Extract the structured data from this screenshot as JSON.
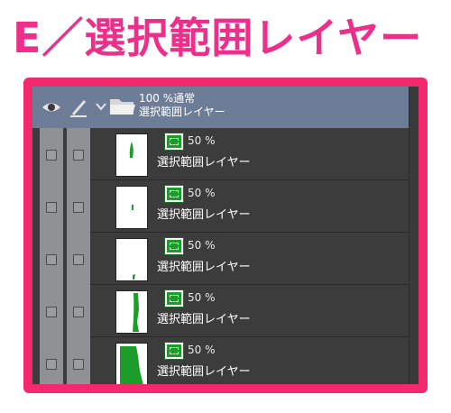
{
  "heading": "E／選択範囲レイヤー",
  "colors": {
    "heading": "#ec2f8a",
    "frame": "#f2296d",
    "header_row": "#6d7d98",
    "mask_green": "#1c9d2a"
  },
  "header": {
    "visibility_icon": "eye-icon",
    "edit_icon": "pen-icon",
    "expand_icon": "chevron-down-icon",
    "folder_icon": "folder-open-icon",
    "folder_opacity_blend": "100 %通常",
    "folder_name": "選択範囲レイヤー"
  },
  "layers": [
    {
      "opacity": "50 %",
      "name": "選択範囲レイヤー",
      "visible": false,
      "locked": false
    },
    {
      "opacity": "50 %",
      "name": "選択範囲レイヤー",
      "visible": false,
      "locked": false
    },
    {
      "opacity": "50 %",
      "name": "選択範囲レイヤー",
      "visible": false,
      "locked": false
    },
    {
      "opacity": "50 %",
      "name": "選択範囲レイヤー",
      "visible": false,
      "locked": false
    },
    {
      "opacity": "50 %",
      "name": "選択範囲レイヤー",
      "visible": false,
      "locked": false
    }
  ]
}
